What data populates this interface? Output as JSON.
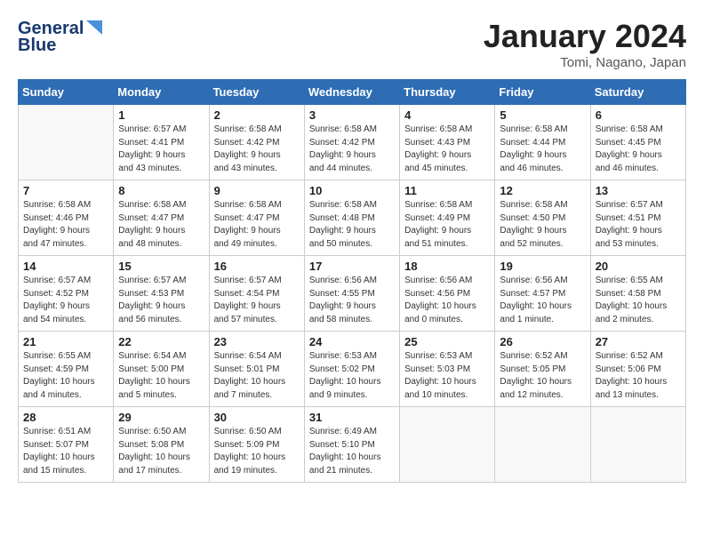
{
  "logo": {
    "line1": "General",
    "line2": "Blue"
  },
  "title": "January 2024",
  "subtitle": "Tomi, Nagano, Japan",
  "days_header": [
    "Sunday",
    "Monday",
    "Tuesday",
    "Wednesday",
    "Thursday",
    "Friday",
    "Saturday"
  ],
  "weeks": [
    [
      {
        "day": "",
        "info": ""
      },
      {
        "day": "1",
        "info": "Sunrise: 6:57 AM\nSunset: 4:41 PM\nDaylight: 9 hours\nand 43 minutes."
      },
      {
        "day": "2",
        "info": "Sunrise: 6:58 AM\nSunset: 4:42 PM\nDaylight: 9 hours\nand 43 minutes."
      },
      {
        "day": "3",
        "info": "Sunrise: 6:58 AM\nSunset: 4:42 PM\nDaylight: 9 hours\nand 44 minutes."
      },
      {
        "day": "4",
        "info": "Sunrise: 6:58 AM\nSunset: 4:43 PM\nDaylight: 9 hours\nand 45 minutes."
      },
      {
        "day": "5",
        "info": "Sunrise: 6:58 AM\nSunset: 4:44 PM\nDaylight: 9 hours\nand 46 minutes."
      },
      {
        "day": "6",
        "info": "Sunrise: 6:58 AM\nSunset: 4:45 PM\nDaylight: 9 hours\nand 46 minutes."
      }
    ],
    [
      {
        "day": "7",
        "info": "Sunrise: 6:58 AM\nSunset: 4:46 PM\nDaylight: 9 hours\nand 47 minutes."
      },
      {
        "day": "8",
        "info": "Sunrise: 6:58 AM\nSunset: 4:47 PM\nDaylight: 9 hours\nand 48 minutes."
      },
      {
        "day": "9",
        "info": "Sunrise: 6:58 AM\nSunset: 4:47 PM\nDaylight: 9 hours\nand 49 minutes."
      },
      {
        "day": "10",
        "info": "Sunrise: 6:58 AM\nSunset: 4:48 PM\nDaylight: 9 hours\nand 50 minutes."
      },
      {
        "day": "11",
        "info": "Sunrise: 6:58 AM\nSunset: 4:49 PM\nDaylight: 9 hours\nand 51 minutes."
      },
      {
        "day": "12",
        "info": "Sunrise: 6:58 AM\nSunset: 4:50 PM\nDaylight: 9 hours\nand 52 minutes."
      },
      {
        "day": "13",
        "info": "Sunrise: 6:57 AM\nSunset: 4:51 PM\nDaylight: 9 hours\nand 53 minutes."
      }
    ],
    [
      {
        "day": "14",
        "info": "Sunrise: 6:57 AM\nSunset: 4:52 PM\nDaylight: 9 hours\nand 54 minutes."
      },
      {
        "day": "15",
        "info": "Sunrise: 6:57 AM\nSunset: 4:53 PM\nDaylight: 9 hours\nand 56 minutes."
      },
      {
        "day": "16",
        "info": "Sunrise: 6:57 AM\nSunset: 4:54 PM\nDaylight: 9 hours\nand 57 minutes."
      },
      {
        "day": "17",
        "info": "Sunrise: 6:56 AM\nSunset: 4:55 PM\nDaylight: 9 hours\nand 58 minutes."
      },
      {
        "day": "18",
        "info": "Sunrise: 6:56 AM\nSunset: 4:56 PM\nDaylight: 10 hours\nand 0 minutes."
      },
      {
        "day": "19",
        "info": "Sunrise: 6:56 AM\nSunset: 4:57 PM\nDaylight: 10 hours\nand 1 minute."
      },
      {
        "day": "20",
        "info": "Sunrise: 6:55 AM\nSunset: 4:58 PM\nDaylight: 10 hours\nand 2 minutes."
      }
    ],
    [
      {
        "day": "21",
        "info": "Sunrise: 6:55 AM\nSunset: 4:59 PM\nDaylight: 10 hours\nand 4 minutes."
      },
      {
        "day": "22",
        "info": "Sunrise: 6:54 AM\nSunset: 5:00 PM\nDaylight: 10 hours\nand 5 minutes."
      },
      {
        "day": "23",
        "info": "Sunrise: 6:54 AM\nSunset: 5:01 PM\nDaylight: 10 hours\nand 7 minutes."
      },
      {
        "day": "24",
        "info": "Sunrise: 6:53 AM\nSunset: 5:02 PM\nDaylight: 10 hours\nand 9 minutes."
      },
      {
        "day": "25",
        "info": "Sunrise: 6:53 AM\nSunset: 5:03 PM\nDaylight: 10 hours\nand 10 minutes."
      },
      {
        "day": "26",
        "info": "Sunrise: 6:52 AM\nSunset: 5:05 PM\nDaylight: 10 hours\nand 12 minutes."
      },
      {
        "day": "27",
        "info": "Sunrise: 6:52 AM\nSunset: 5:06 PM\nDaylight: 10 hours\nand 13 minutes."
      }
    ],
    [
      {
        "day": "28",
        "info": "Sunrise: 6:51 AM\nSunset: 5:07 PM\nDaylight: 10 hours\nand 15 minutes."
      },
      {
        "day": "29",
        "info": "Sunrise: 6:50 AM\nSunset: 5:08 PM\nDaylight: 10 hours\nand 17 minutes."
      },
      {
        "day": "30",
        "info": "Sunrise: 6:50 AM\nSunset: 5:09 PM\nDaylight: 10 hours\nand 19 minutes."
      },
      {
        "day": "31",
        "info": "Sunrise: 6:49 AM\nSunset: 5:10 PM\nDaylight: 10 hours\nand 21 minutes."
      },
      {
        "day": "",
        "info": ""
      },
      {
        "day": "",
        "info": ""
      },
      {
        "day": "",
        "info": ""
      }
    ]
  ]
}
